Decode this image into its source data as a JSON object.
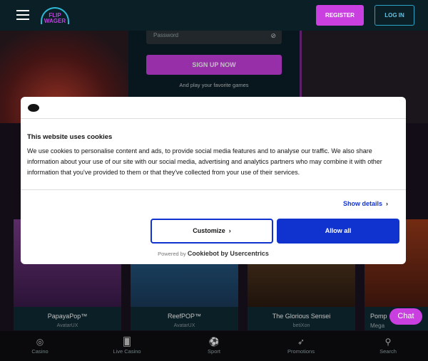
{
  "header": {
    "logo": "FLIP WAGER",
    "register": "REGISTER",
    "login": "LOG IN"
  },
  "form": {
    "password_placeholder": "Password",
    "signup": "SIGN UP NOW",
    "tagline": "And play your favorite games"
  },
  "cookie": {
    "title": "This website uses cookies",
    "body": "We use cookies to personalise content and ads, to provide social media features and to analyse our traffic. We also share information about your use of our site with our social media, advertising and analytics partners who may combine it with other information that you've provided to them or that they've collected from your use of their services.",
    "show_details": "Show details",
    "customize": "Customize",
    "allow_all": "Allow all",
    "powered_by": "Powered by",
    "brand": "Cookiebot by Usercentrics"
  },
  "games": [
    {
      "title": "PapayaPop™",
      "provider": "AvatarUX",
      "color": "#5a2a6a"
    },
    {
      "title": "ReefPOP™",
      "provider": "AvatarUX",
      "color": "#1e4f7a"
    },
    {
      "title": "The Glorious Sensei",
      "provider": "betiXon",
      "color": "#5a3a1a"
    },
    {
      "title": "Pomp",
      "provider": "Mega",
      "color": "#6a2a1a"
    }
  ],
  "nav": [
    {
      "label": "Casino",
      "icon": "casino-icon"
    },
    {
      "label": "Live Casino",
      "icon": "cards-icon"
    },
    {
      "label": "Sport",
      "icon": "soccer-ball-icon"
    },
    {
      "label": "Promotions",
      "icon": "rocket-icon"
    },
    {
      "label": "Search",
      "icon": "search-icon"
    }
  ],
  "chat": "Chat"
}
